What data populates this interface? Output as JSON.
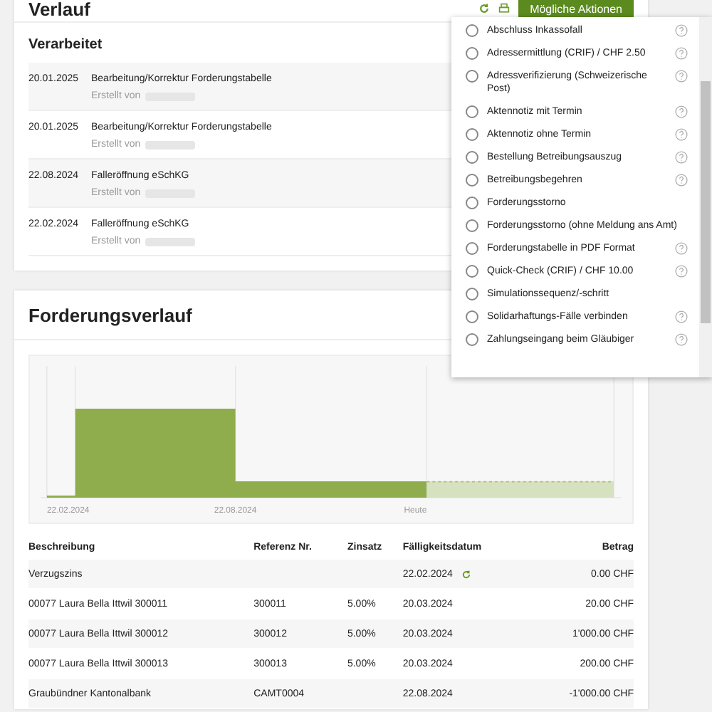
{
  "history": {
    "title": "Verlauf",
    "actions_button": "Mögliche Aktionen",
    "section": "Verarbeitet",
    "entries": [
      {
        "date": "20.01.2025",
        "title": "Bearbeitung/Korrektur Forderungstabelle",
        "created_by": "Erstellt von"
      },
      {
        "date": "20.01.2025",
        "title": "Bearbeitung/Korrektur Forderungstabelle",
        "created_by": "Erstellt von"
      },
      {
        "date": "22.08.2024",
        "title": "Falleröffnung eSchKG",
        "created_by": "Erstellt von"
      },
      {
        "date": "22.02.2024",
        "title": "Falleröffnung eSchKG",
        "created_by": "Erstellt von"
      }
    ]
  },
  "actions_menu": {
    "items": [
      {
        "label": "Abschluss Inkassofall",
        "help": true,
        "selected": false
      },
      {
        "label": "Adressermittlung (CRIF) / CHF 2.50",
        "help": true,
        "selected": false
      },
      {
        "label": "Adressverifizierung (Schweizerische Post)",
        "help": true,
        "selected": false
      },
      {
        "label": "Aktennotiz mit Termin",
        "help": true,
        "selected": false
      },
      {
        "label": "Aktennotiz ohne Termin",
        "help": true,
        "selected": false
      },
      {
        "label": "Bestellung Betreibungsauszug",
        "help": true,
        "selected": false
      },
      {
        "label": "Betreibungsbegehren",
        "help": true,
        "selected": false
      },
      {
        "label": "Forderungsstorno",
        "help": false,
        "selected": false
      },
      {
        "label": "Forderungsstorno (ohne Meldung ans Amt)",
        "help": false,
        "selected": false
      },
      {
        "label": "Forderungstabelle in PDF Format",
        "help": true,
        "selected": false
      },
      {
        "label": "Quick-Check (CRIF) / CHF 10.00",
        "help": true,
        "selected": false
      },
      {
        "label": "Simulationssequenz/-schritt",
        "help": false,
        "selected": false
      },
      {
        "label": "Solidarhaftungs-Fälle verbinden",
        "help": true,
        "selected": false
      },
      {
        "label": "Zahlungseingang beim Gläubiger",
        "help": true,
        "selected": false
      }
    ]
  },
  "claims": {
    "title": "Forderungsverlauf",
    "chart_labels": [
      "22.02.2024",
      "22.08.2024",
      "Heute"
    ],
    "table": {
      "columns": [
        "Beschreibung",
        "Referenz Nr.",
        "Zinsatz",
        "Fälligkeitsdatum",
        "Betrag"
      ],
      "rows": [
        {
          "cells": [
            "Verzugszins",
            "",
            "",
            "22.02.2024",
            "0.00 CHF"
          ],
          "refresh": true
        },
        {
          "cells": [
            "00077 Laura Bella Ittwil 300011",
            "300011",
            "5.00%",
            "20.03.2024",
            "20.00 CHF"
          ],
          "refresh": false
        },
        {
          "cells": [
            "00077 Laura Bella Ittwil 300012",
            "300012",
            "5.00%",
            "20.03.2024",
            "1'000.00 CHF"
          ],
          "refresh": false
        },
        {
          "cells": [
            "00077 Laura Bella Ittwil 300013",
            "300013",
            "5.00%",
            "20.03.2024",
            "200.00 CHF"
          ],
          "refresh": false
        },
        {
          "cells": [
            "Graubündner Kantonalbank",
            "CAMT0004",
            "",
            "22.08.2024",
            "-1'000.00 CHF"
          ],
          "refresh": false
        }
      ]
    }
  }
}
